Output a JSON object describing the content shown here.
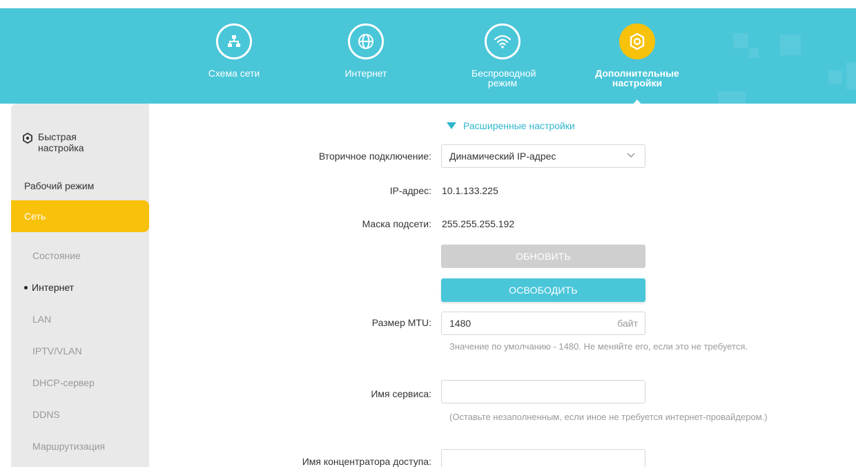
{
  "nav": {
    "items": [
      {
        "label": "Схема сети",
        "icon": "network-map-icon"
      },
      {
        "label": "Интернет",
        "icon": "globe-icon"
      },
      {
        "label": "Беспроводной режим",
        "icon": "wifi-icon"
      },
      {
        "label": "Дополнительные настройки",
        "icon": "gear-icon"
      }
    ],
    "active_color": "#f8c10a",
    "band_color": "#4ac6d9"
  },
  "sidebar": {
    "quick_setup": "Быстрая настройка",
    "operation_mode": "Рабочий режим",
    "network": "Сеть",
    "sub_items": [
      "Состояние",
      "Интернет",
      "LAN",
      "IPTV/VLAN",
      "DHCP-сервер",
      "DDNS",
      "Маршрутизация"
    ],
    "active_sub": "Интернет"
  },
  "form": {
    "advanced_toggle": "Расширенные настройки",
    "secondary_connection": {
      "label": "Вторичное подключение:",
      "value": "Динамический IP-адрес"
    },
    "ip": {
      "label": "IP-адрес:",
      "value": "10.1.133.225"
    },
    "mask": {
      "label": "Маска подсети:",
      "value": "255.255.255.192"
    },
    "renew_button": "ОБНОВИТЬ",
    "release_button": "ОСВОБОДИТЬ",
    "mtu": {
      "label": "Размер MTU:",
      "value": "1480",
      "unit": "байт",
      "hint": "Значение по умолчанию - 1480. Не меняйте его, если это не требуется."
    },
    "service_name": {
      "label": "Имя сервиса:",
      "value": "",
      "hint": "(Оставьте незаполненным, если иное не требуется интернет-провайдером.)"
    },
    "ac_name": {
      "label": "Имя концентратора доступа:",
      "value": ""
    }
  }
}
